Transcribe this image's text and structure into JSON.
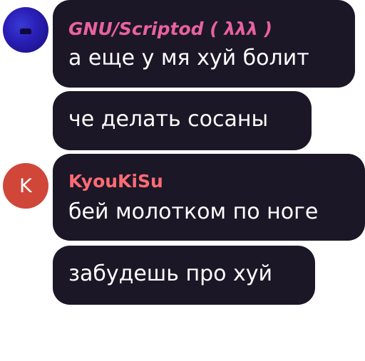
{
  "messages": [
    {
      "author": "GNU/Scriptod ( λλλ )",
      "avatar_icon": "dark-blob-avatar",
      "avatar_color": "#2a20b8",
      "name_color": "#e8629f",
      "lines": [
        "а еще у мя хуй болит",
        "че делать сосаны"
      ]
    },
    {
      "author": "KyouKiSu",
      "avatar_letter": "K",
      "avatar_color": "#d0473a",
      "name_color": "#ff6b74",
      "lines": [
        "бей молотком по ноге",
        "забудешь про хуй"
      ]
    }
  ],
  "bubble_color": "#1b1726"
}
